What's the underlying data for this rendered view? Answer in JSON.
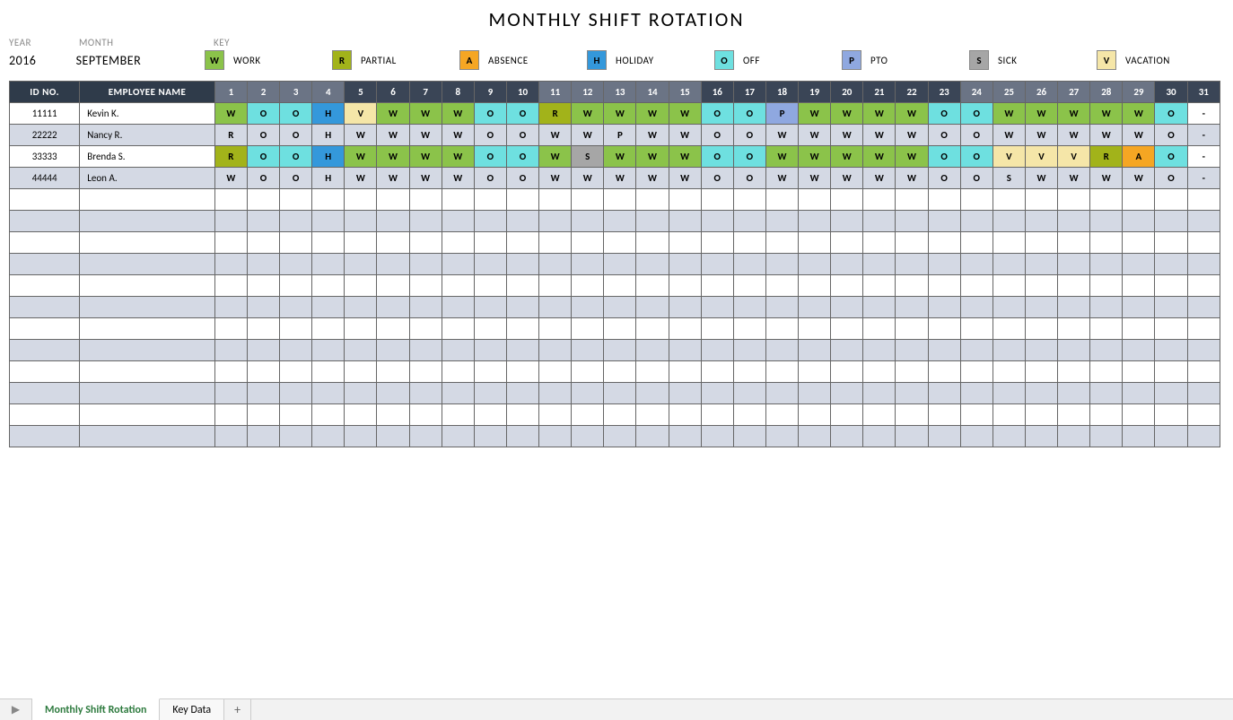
{
  "title": "MONTHLY SHIFT ROTATION",
  "labels": {
    "year": "YEAR",
    "month": "MONTH",
    "key": "KEY",
    "id": "ID NO.",
    "name": "EMPLOYEE NAME"
  },
  "year": "2016",
  "month": "SEPTEMBER",
  "key": [
    {
      "code": "W",
      "label": "WORK",
      "cls": "sw-W"
    },
    {
      "code": "R",
      "label": "PARTIAL",
      "cls": "sw-R"
    },
    {
      "code": "A",
      "label": "ABSENCE",
      "cls": "sw-A"
    },
    {
      "code": "H",
      "label": "HOLIDAY",
      "cls": "sw-H"
    },
    {
      "code": "O",
      "label": "OFF",
      "cls": "sw-O"
    },
    {
      "code": "P",
      "label": "PTO",
      "cls": "sw-P"
    },
    {
      "code": "S",
      "label": "SICK",
      "cls": "sw-S"
    },
    {
      "code": "V",
      "label": "VACATION",
      "cls": "sw-V"
    }
  ],
  "days": [
    1,
    2,
    3,
    4,
    5,
    6,
    7,
    8,
    9,
    10,
    11,
    12,
    13,
    14,
    15,
    16,
    17,
    18,
    19,
    20,
    21,
    22,
    23,
    24,
    25,
    26,
    27,
    28,
    29,
    30,
    31
  ],
  "day_header_light": [
    1,
    2,
    3,
    4,
    11,
    12,
    13,
    14,
    15,
    24,
    25,
    26,
    27,
    28,
    29
  ],
  "employees": [
    {
      "id": "11111",
      "name": "Kevin K.",
      "shifts": [
        "W",
        "O",
        "O",
        "H",
        "V",
        "W",
        "W",
        "W",
        "O",
        "O",
        "R",
        "W",
        "W",
        "W",
        "W",
        "O",
        "O",
        "P",
        "W",
        "W",
        "W",
        "W",
        "O",
        "O",
        "W",
        "W",
        "W",
        "W",
        "W",
        "O",
        "-"
      ]
    },
    {
      "id": "22222",
      "name": "Nancy R.",
      "shifts": [
        "R",
        "O",
        "O",
        "H",
        "W",
        "W",
        "W",
        "W",
        "O",
        "O",
        "W",
        "W",
        "P",
        "W",
        "W",
        "O",
        "O",
        "W",
        "W",
        "W",
        "W",
        "W",
        "O",
        "O",
        "W",
        "W",
        "W",
        "W",
        "W",
        "O",
        "-"
      ]
    },
    {
      "id": "33333",
      "name": "Brenda S.",
      "shifts": [
        "R",
        "O",
        "O",
        "H",
        "W",
        "W",
        "W",
        "W",
        "O",
        "O",
        "W",
        "S",
        "W",
        "W",
        "W",
        "O",
        "O",
        "W",
        "W",
        "W",
        "W",
        "W",
        "O",
        "O",
        "V",
        "V",
        "V",
        "R",
        "A",
        "O",
        "-"
      ]
    },
    {
      "id": "44444",
      "name": "Leon A.",
      "shifts": [
        "W",
        "O",
        "O",
        "H",
        "W",
        "W",
        "W",
        "W",
        "O",
        "O",
        "W",
        "W",
        "W",
        "W",
        "W",
        "O",
        "O",
        "W",
        "W",
        "W",
        "W",
        "W",
        "O",
        "O",
        "S",
        "W",
        "W",
        "W",
        "W",
        "O",
        "-"
      ]
    }
  ],
  "empty_rows": 12,
  "tabs": {
    "active": "Monthly Shift Rotation",
    "other": "Key Data"
  }
}
